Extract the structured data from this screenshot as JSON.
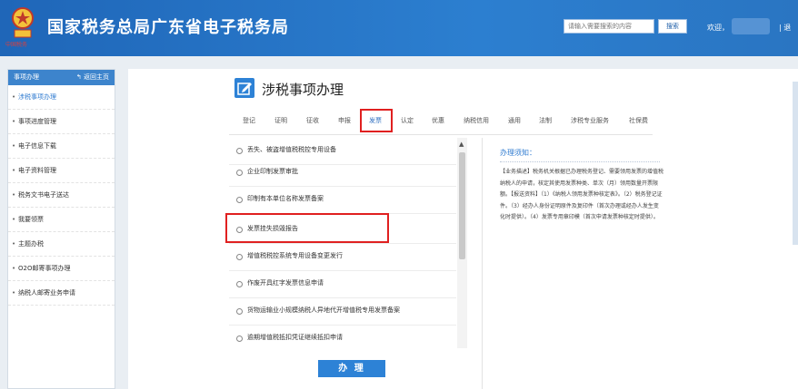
{
  "header": {
    "emblem_text": "中国税务",
    "site_title": "国家税务总局广东省电子税务局",
    "search_placeholder": "请输入需要搜索的内容",
    "search_button": "搜索",
    "welcome": "欢迎，",
    "exit": "| 退"
  },
  "sidebar": {
    "title": "事项办理",
    "back_label": "返回主页",
    "items": [
      {
        "label": "涉税事项办理",
        "active": true
      },
      {
        "label": "事项进度管理"
      },
      {
        "label": "电子信息下载"
      },
      {
        "label": "电子资料管理"
      },
      {
        "label": "税务文书电子送达"
      },
      {
        "label": "我要领票"
      },
      {
        "label": "主题办税"
      },
      {
        "label": "O2O邮寄事项办理"
      },
      {
        "label": "纳税人邮寄业务申请"
      }
    ]
  },
  "main": {
    "title": "涉税事项办理",
    "tabs": [
      "登记",
      "证明",
      "征收",
      "申报",
      "发票",
      "认定",
      "优惠",
      "纳税信用",
      "通用",
      "法制",
      "涉税专业服务",
      "社保费"
    ],
    "active_tab": "发票",
    "items": [
      "丢失、被盗增值税税控专用设备",
      "企业印制发票审批",
      "印制有本单位名称发票备案",
      "发票挂失损毁报告",
      "增值税税控系统专用设备变更发行",
      "作废开具红字发票信息申请",
      "货物运输业小规模纳税人异地代开增值税专用发票备案",
      "逾期增值税抵扣凭证继续抵扣申请"
    ],
    "highlighted_item": "发票挂失损毁报告",
    "notice_title": "办理须知：",
    "notice_text": "【业务描述】税务机关根据已办理税务登记、需要领用发票的增值税纳税人的申请，核定其使用发票种类、单次（月）领用数量开票限额。【报送资料】（1）《纳税人领用发票种核定表》。（2）税务登记证件。（3）经办人身份证明原件及复印件（首次办理或经办人发生变化时提供）。（4）发票专用章印模（首次申请发票种核定时提供）。",
    "submit_label": "办 理"
  },
  "colors": {
    "header_blue": "#2c7fd0",
    "highlight_red": "#e02020",
    "accent": "#2d82d6"
  }
}
